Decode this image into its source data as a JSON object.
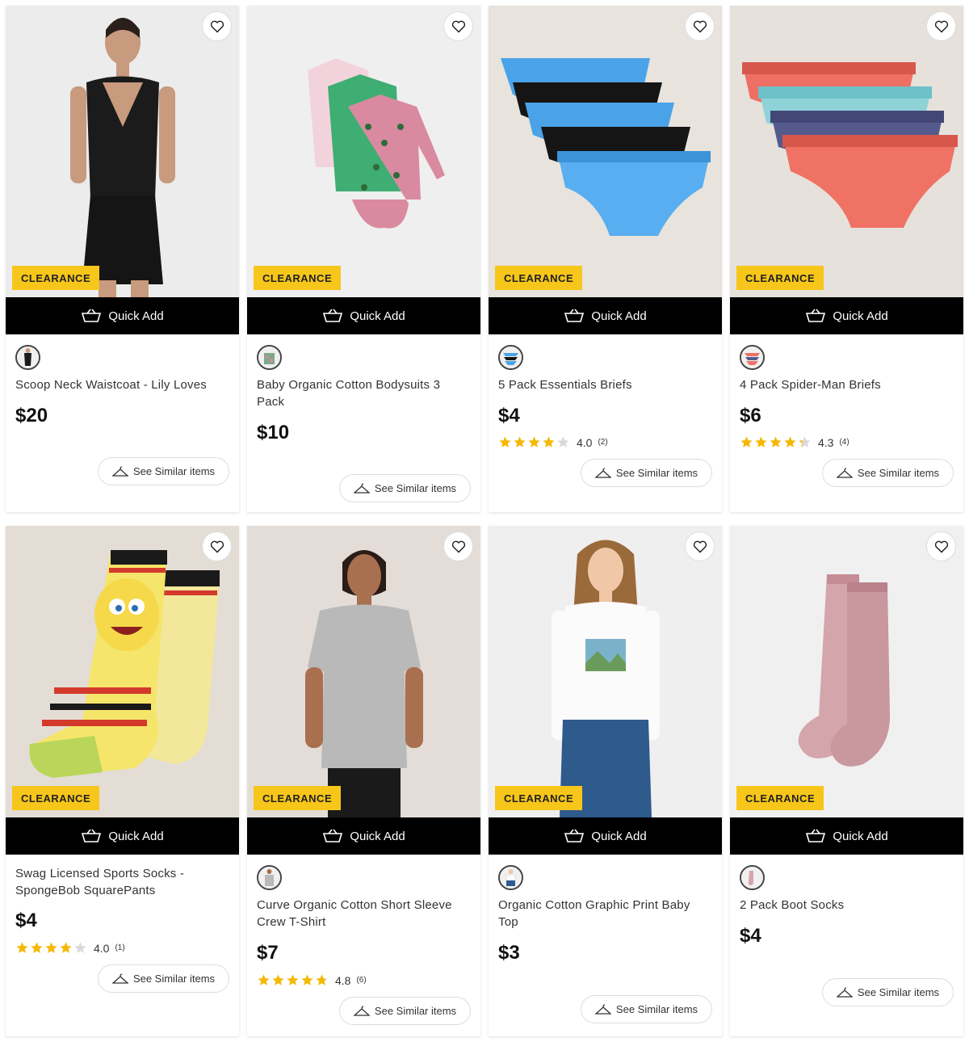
{
  "common": {
    "quick_add_label": "Quick Add",
    "see_similar_label": "See Similar items",
    "wishlist_icon": "heart-icon",
    "basket_icon": "basket-icon",
    "colors": {
      "badge": "#f7c61a",
      "quick_add_bg": "#000000",
      "star": "#f5b800"
    }
  },
  "products": [
    {
      "badge": "CLEARANCE",
      "title": "Scoop Neck Waistcoat - Lily Loves",
      "price": "$20"
    },
    {
      "badge": "CLEARANCE",
      "title": "Baby Organic Cotton Bodysuits 3 Pack",
      "price": "$10"
    },
    {
      "badge": "CLEARANCE",
      "title": "5 Pack Essentials Briefs",
      "price": "$4",
      "rating_value": "4.0",
      "rating_count": "(2)",
      "stars": 4
    },
    {
      "badge": "CLEARANCE",
      "title": "4 Pack Spider-Man Briefs",
      "price": "$6",
      "rating_value": "4.3",
      "rating_count": "(4)",
      "stars": 4.3
    },
    {
      "badge": "CLEARANCE",
      "title": "Swag Licensed Sports Socks - SpongeBob SquarePants",
      "price": "$4",
      "rating_value": "4.0",
      "rating_count": "(1)",
      "stars": 4
    },
    {
      "badge": "CLEARANCE",
      "title": "Curve Organic Cotton Short Sleeve Crew T-Shirt",
      "price": "$7",
      "rating_value": "4.8",
      "rating_count": "(6)",
      "stars": 4.8
    },
    {
      "badge": "CLEARANCE",
      "title": "Organic Cotton Graphic Print Baby Top",
      "price": "$3"
    },
    {
      "badge": "CLEARANCE",
      "title": "2 Pack Boot Socks",
      "price": "$4"
    }
  ]
}
